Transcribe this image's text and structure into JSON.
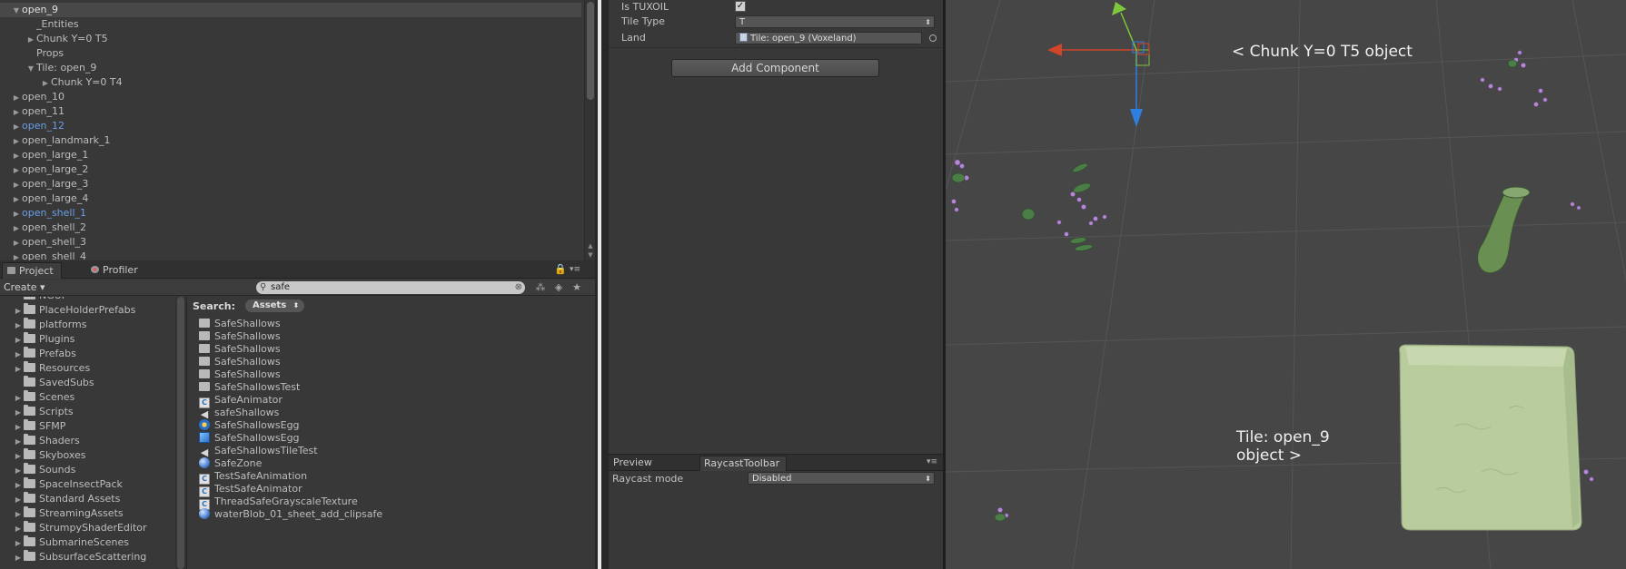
{
  "hierarchy": {
    "items": [
      {
        "label": "open_9",
        "indent": 0,
        "arrow": "down",
        "selected": true,
        "blue": false
      },
      {
        "label": "_Entities",
        "indent": 1,
        "arrow": "",
        "selected": false,
        "blue": false
      },
      {
        "label": "Chunk Y=0 T5",
        "indent": 1,
        "arrow": "right",
        "selected": false,
        "blue": false
      },
      {
        "label": "Props",
        "indent": 1,
        "arrow": "",
        "selected": false,
        "blue": false
      },
      {
        "label": "Tile: open_9",
        "indent": 1,
        "arrow": "down",
        "selected": false,
        "blue": false
      },
      {
        "label": "Chunk Y=0 T4",
        "indent": 2,
        "arrow": "right",
        "selected": false,
        "blue": false
      },
      {
        "label": "open_10",
        "indent": 0,
        "arrow": "right",
        "selected": false,
        "blue": false
      },
      {
        "label": "open_11",
        "indent": 0,
        "arrow": "right",
        "selected": false,
        "blue": false
      },
      {
        "label": "open_12",
        "indent": 0,
        "arrow": "right",
        "selected": false,
        "blue": true
      },
      {
        "label": "open_landmark_1",
        "indent": 0,
        "arrow": "right",
        "selected": false,
        "blue": false
      },
      {
        "label": "open_large_1",
        "indent": 0,
        "arrow": "right",
        "selected": false,
        "blue": false
      },
      {
        "label": "open_large_2",
        "indent": 0,
        "arrow": "right",
        "selected": false,
        "blue": false
      },
      {
        "label": "open_large_3",
        "indent": 0,
        "arrow": "right",
        "selected": false,
        "blue": false
      },
      {
        "label": "open_large_4",
        "indent": 0,
        "arrow": "right",
        "selected": false,
        "blue": false
      },
      {
        "label": "open_shell_1",
        "indent": 0,
        "arrow": "right",
        "selected": false,
        "blue": true
      },
      {
        "label": "open_shell_2",
        "indent": 0,
        "arrow": "right",
        "selected": false,
        "blue": false
      },
      {
        "label": "open_shell_3",
        "indent": 0,
        "arrow": "right",
        "selected": false,
        "blue": false
      },
      {
        "label": "open_shell_4",
        "indent": 0,
        "arrow": "right",
        "selected": false,
        "blue": false
      }
    ]
  },
  "project": {
    "tabs": [
      {
        "label": "Project",
        "icon": "folder-icon",
        "active": true
      },
      {
        "label": "Profiler",
        "icon": "profiler-icon",
        "active": false
      }
    ],
    "create_label": "Create ▾",
    "search_value": "safe",
    "search_heading": "Search:",
    "search_scope": "Assets",
    "folders": [
      "NGUI",
      "PlaceHolderPrefabs",
      "platforms",
      "Plugins",
      "Prefabs",
      "Resources",
      "SavedSubs",
      "Scenes",
      "Scripts",
      "SFMP",
      "Shaders",
      "Skyboxes",
      "Sounds",
      "SpaceInsectPack",
      "Standard Assets",
      "StreamingAssets",
      "StrumpyShaderEditor",
      "SubmarineScenes",
      "SubsurfaceScattering"
    ],
    "results": [
      {
        "label": "SafeShallows",
        "icon": "folder"
      },
      {
        "label": "SafeShallows",
        "icon": "folder"
      },
      {
        "label": "SafeShallows",
        "icon": "folder"
      },
      {
        "label": "SafeShallows",
        "icon": "folder"
      },
      {
        "label": "SafeShallows",
        "icon": "folder"
      },
      {
        "label": "SafeShallowsTest",
        "icon": "folder"
      },
      {
        "label": "SafeAnimator",
        "icon": "script"
      },
      {
        "label": "safeShallows",
        "icon": "audio"
      },
      {
        "label": "SafeShallowsEgg",
        "icon": "anim"
      },
      {
        "label": "SafeShallowsEgg",
        "icon": "prefab"
      },
      {
        "label": "SafeShallowsTileTest",
        "icon": "audio"
      },
      {
        "label": "SafeZone",
        "icon": "sphere"
      },
      {
        "label": "TestSafeAnimation",
        "icon": "script"
      },
      {
        "label": "TestSafeAnimator",
        "icon": "script"
      },
      {
        "label": "ThreadSafeGrayscaleTexture",
        "icon": "script"
      },
      {
        "label": "waterBlob_01_sheet_add_clipsafe",
        "icon": "sphere"
      }
    ]
  },
  "inspector": {
    "is_tuxoil_label": "Is TUXOIL",
    "is_tuxoil_checked": true,
    "tile_type_label": "Tile Type",
    "tile_type_value": "T",
    "land_label": "Land",
    "land_value": "Tile: open_9 (Voxeland)",
    "add_component_label": "Add Component",
    "preview_label": "Preview",
    "raycast_tab_label": "RaycastToolbar",
    "raycast_mode_label": "Raycast mode",
    "raycast_mode_value": "Disabled"
  },
  "scene": {
    "annotation_top": "< Chunk Y=0 T5 object",
    "annotation_bottom_line1": "Tile: open_9",
    "annotation_bottom_line2": "object >",
    "colors": {
      "background": "#464646",
      "gizmo_x": "#d2452a",
      "gizmo_y": "#7ec63b",
      "gizmo_z": "#2f7fe0",
      "cube": "#b9cc9e"
    }
  }
}
